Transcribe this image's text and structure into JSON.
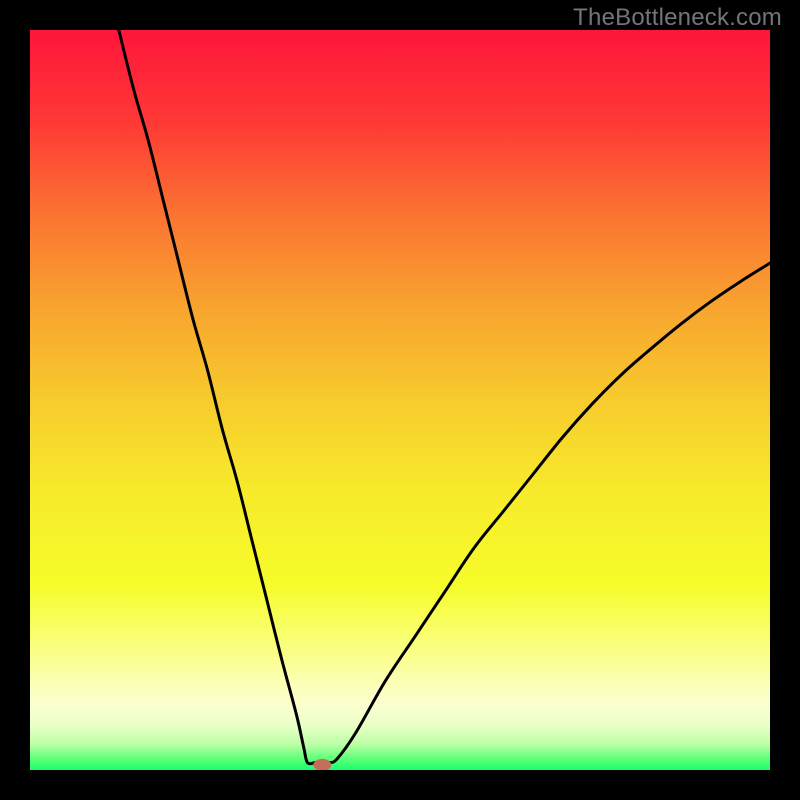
{
  "watermark": "TheBottleneck.com",
  "chart_data": {
    "type": "line",
    "title": "",
    "xlabel": "",
    "ylabel": "",
    "xlim": [
      0,
      100
    ],
    "ylim": [
      0,
      100
    ],
    "grid": false,
    "legend": false,
    "background_gradient_stops": [
      {
        "offset": 0.0,
        "color": "#fe153b"
      },
      {
        "offset": 0.125,
        "color": "#fe3935"
      },
      {
        "offset": 0.25,
        "color": "#fb7432"
      },
      {
        "offset": 0.375,
        "color": "#f8a42f"
      },
      {
        "offset": 0.5,
        "color": "#f7cb2d"
      },
      {
        "offset": 0.625,
        "color": "#f7eb2b"
      },
      {
        "offset": 0.75,
        "color": "#f6fc2a"
      },
      {
        "offset": 0.82,
        "color": "#f9ff70"
      },
      {
        "offset": 0.87,
        "color": "#fbffa8"
      },
      {
        "offset": 0.91,
        "color": "#fcffce"
      },
      {
        "offset": 0.94,
        "color": "#e9ffc7"
      },
      {
        "offset": 0.965,
        "color": "#bcffa6"
      },
      {
        "offset": 0.985,
        "color": "#5dff79"
      },
      {
        "offset": 1.0,
        "color": "#18ff6c"
      }
    ],
    "series": [
      {
        "name": "left-branch",
        "x": [
          12,
          14,
          16,
          18,
          20,
          22,
          24,
          26,
          28,
          30,
          32,
          34,
          36,
          37,
          37.5,
          38.5
        ],
        "y": [
          100,
          92,
          85,
          77,
          69,
          61,
          54,
          46,
          39,
          31,
          23,
          15,
          7.5,
          3,
          1,
          1
        ]
      },
      {
        "name": "right-branch",
        "x": [
          40.5,
          41.5,
          44,
          48,
          52,
          56,
          60,
          64,
          68,
          72,
          76,
          80,
          84,
          88,
          92,
          96,
          100
        ],
        "y": [
          1,
          1.5,
          5,
          12,
          18,
          24,
          30,
          35,
          40,
          45,
          49.5,
          53.5,
          57,
          60.3,
          63.3,
          66,
          68.5
        ]
      }
    ],
    "marker": {
      "name": "bottleneck-marker",
      "x": 39.5,
      "y": 0.7,
      "color": "#c36d5b"
    }
  }
}
